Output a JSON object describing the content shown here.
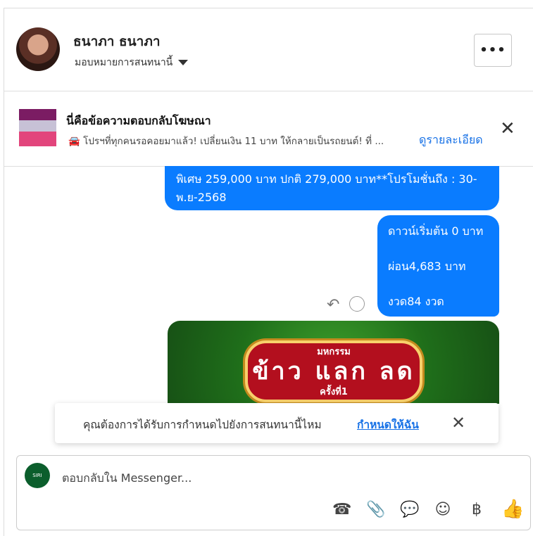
{
  "header": {
    "name": "ธนาภา ธนาภา",
    "assign_label": "มอบหมายการสนทนานี้",
    "more_label": "•••"
  },
  "ad": {
    "title": "นี่คือข้อความตอบกลับโฆษณา",
    "text": "🚘 โปรฯที่ทุกคนรอคอยมาแล้ว! เปลี่ยนเงิน 11 บาท ให้กลายเป็นรถยนต์! ที่ ...",
    "link": "ดูรายละเอียด",
    "close": "✕"
  },
  "messages": {
    "bubble1": "พิเศษ 259,000 บาท  ปกติ 279,000 บาท**โปรโมชั่นถึง : 30-พ.ย-2568",
    "bubble2_lines": [
      "ดาวน์เริ่มต้น 0 บาท",
      "ผ่อน4,683 บาท",
      "งวด84 งวด"
    ],
    "promo_small": "มหกรรม",
    "promo_big": "ข้าว แลก ลด",
    "promo_sub": "ครั้งที่1"
  },
  "notice": {
    "text": "คุณต้องการได้รับการกำหนดไปยังการสนทนานี้ไหม",
    "link": "กำหนดให้ฉัน",
    "close": "✕"
  },
  "composer": {
    "placeholder": "ตอบกลับใน Messenger...",
    "page_icon_text": "SIRI"
  },
  "icons": {
    "call": "call-add-icon",
    "attach": "paperclip-icon",
    "saved": "chat-bubble-icon",
    "emoji": "smiley-icon",
    "baht": "baht-icon",
    "like": "thumbs-up-icon"
  }
}
